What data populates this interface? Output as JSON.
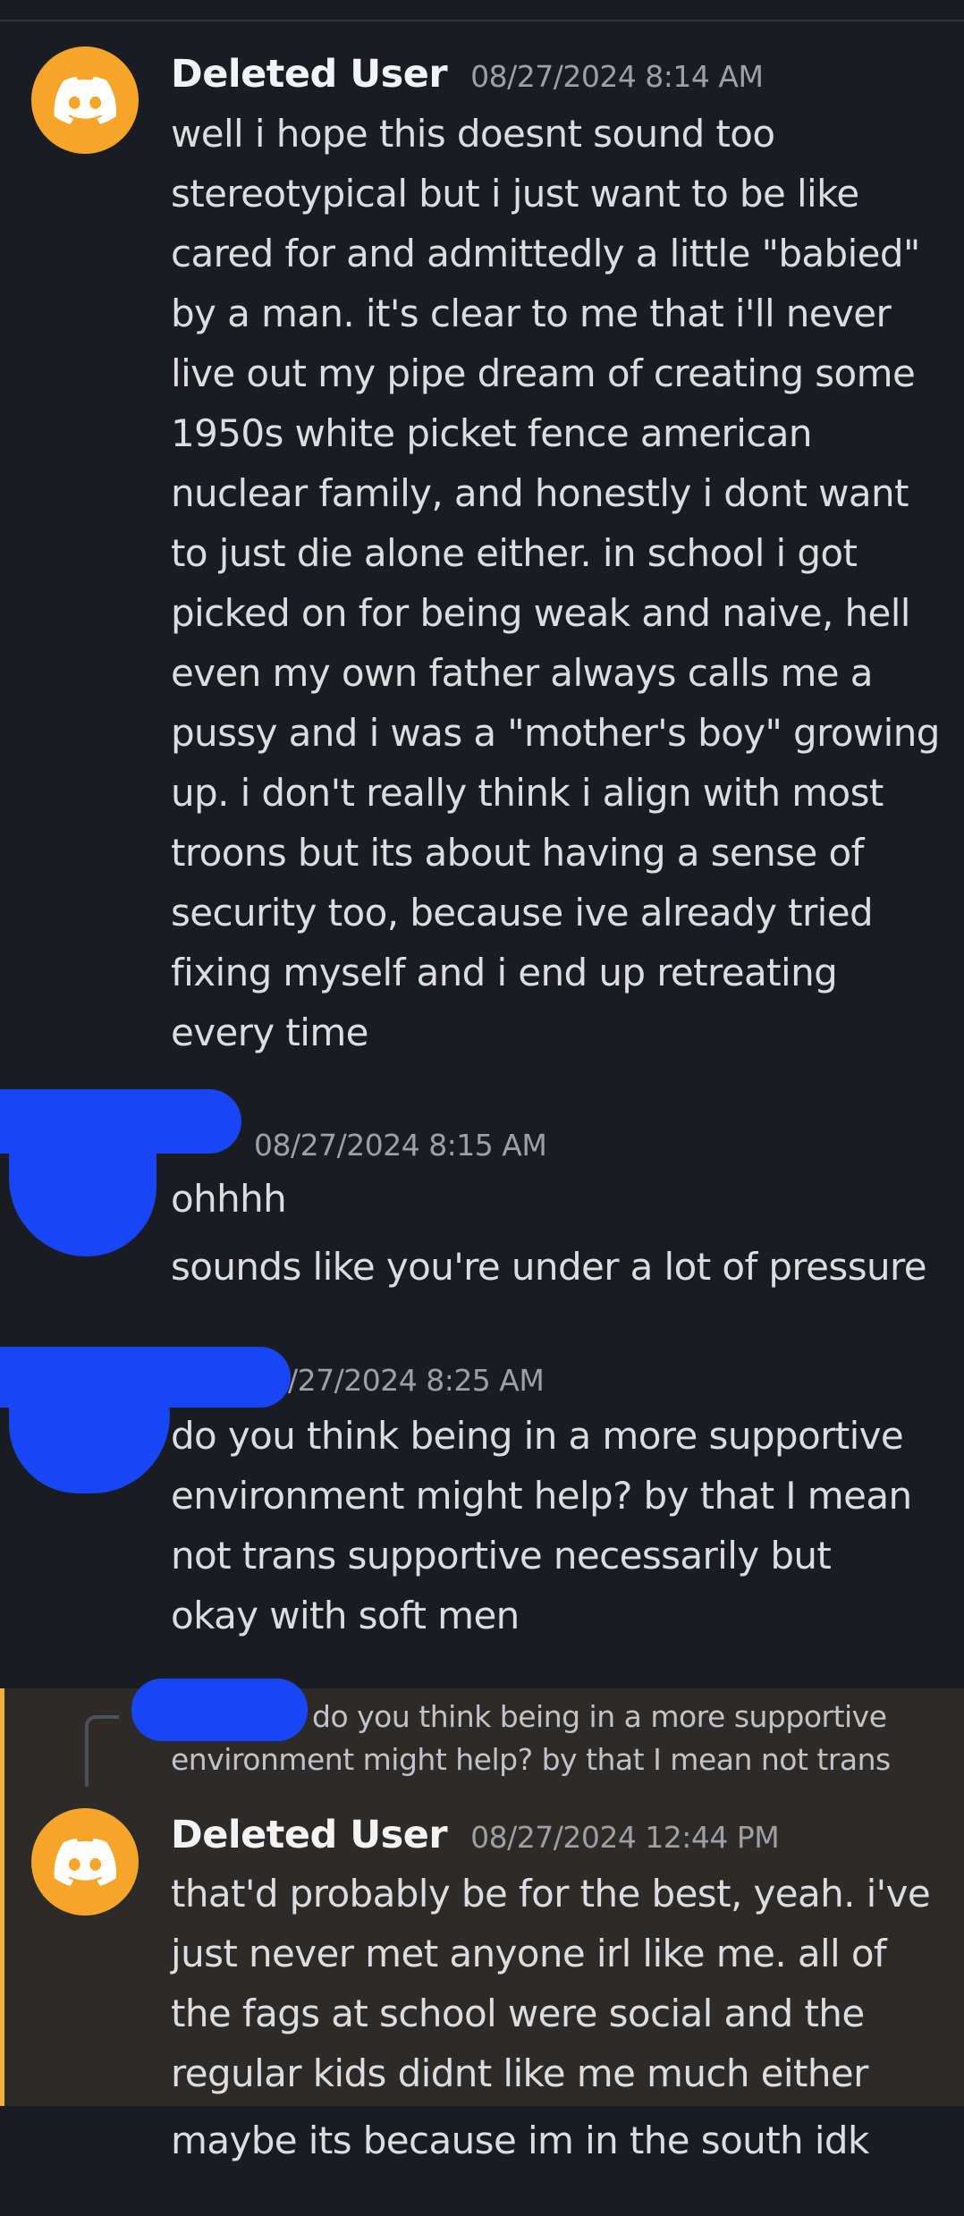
{
  "messages": [
    {
      "username": "Deleted User",
      "timestamp": "08/27/2024 8:14 AM",
      "lines": [
        "well i hope this doesnt sound too",
        "stereotypical but i just want to be like",
        "cared for and admittedly a little \"babied\"",
        "by a man. it's clear to me that i'll never",
        "live out my pipe dream of creating some",
        "1950s white picket fence american",
        "nuclear family, and honestly i dont want",
        "to just die alone either. in school i got",
        "picked on for being weak and naive, hell",
        "even my own father always calls me a",
        "pussy and i was a \"mother's boy\" growing",
        "up. i don't really think i align with most",
        "troons but its about having a sense of",
        "security too, because ive already tried",
        "fixing myself and i end up retreating",
        "every time"
      ]
    },
    {
      "timestamp": "08/27/2024 8:15 AM",
      "lines": [
        "ohhhh",
        "sounds like you're under a lot of pressure"
      ]
    },
    {
      "timestamp": "/27/2024 8:25 AM",
      "lines": [
        "do you think being in a more supportive",
        "environment might help? by that I mean",
        "not trans supportive necessarily but",
        "okay with soft men"
      ]
    },
    {
      "reply_preview": [
        "do you think being in a more supportive",
        "environment might help? by that I mean not trans"
      ],
      "username": "Deleted User",
      "timestamp": "08/27/2024 12:44 PM",
      "lines": [
        "that'd probably be for the best, yeah. i've",
        "just never met anyone irl like me. all of",
        "the fags at school were social and the",
        "regular kids didnt like me much either"
      ]
    },
    {
      "lines": [
        "maybe its because im in the south idk"
      ]
    }
  ],
  "colors": {
    "background": "#1b1c21",
    "avatar": "#f4a52a",
    "redaction": "#1846f5",
    "reply_highlight": "#2d2b29",
    "reply_accent": "#f0b232"
  },
  "icons": {
    "avatar": "discord-logo-icon"
  }
}
